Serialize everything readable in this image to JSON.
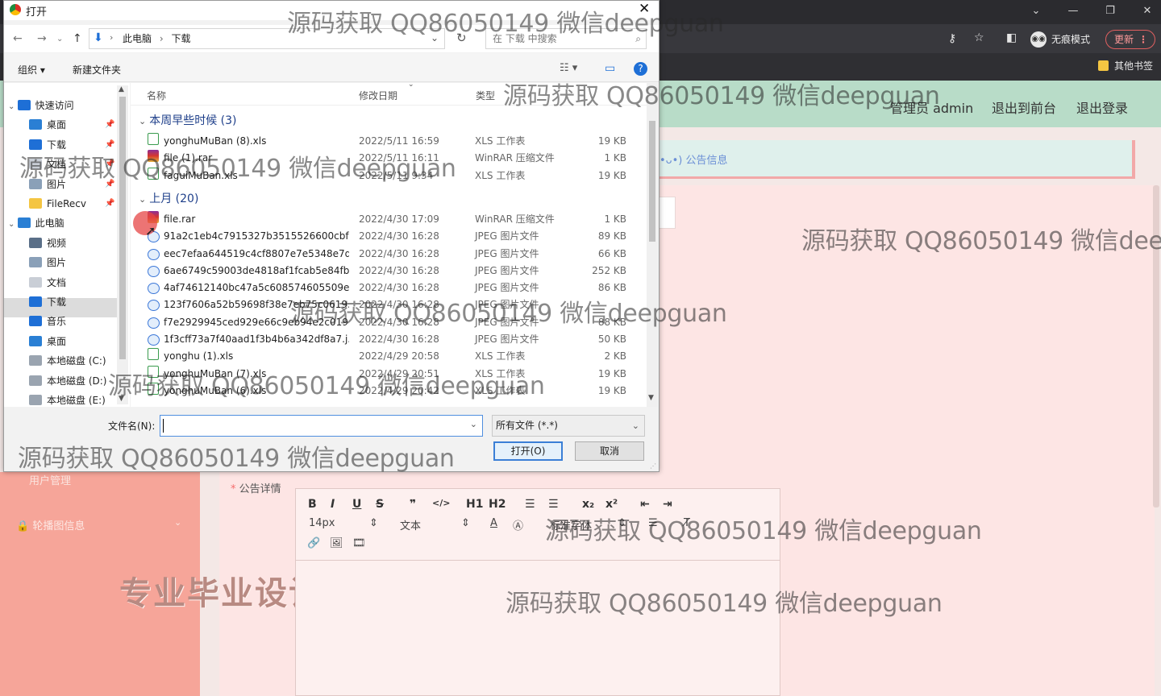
{
  "browser": {
    "window_controls": [
      "⌄",
      "—",
      "❐",
      "✕"
    ],
    "incognito_label": "无痕模式",
    "update_label": "更新",
    "bookmark_label": "其他书签"
  },
  "page": {
    "header_links": [
      "管理员 admin",
      "退出到前台",
      "退出登录"
    ],
    "notice_label": "•ᴗ•) 公告信息",
    "sidebar_items": [
      "用户管理",
      "轮播图信息"
    ],
    "stamp_text": "专业毕业设计代做",
    "field_label": "公告详情",
    "editor": {
      "toolbar_row1": [
        "B",
        "I",
        "U",
        "S",
        "❞",
        "</>",
        "H1",
        "H2",
        "☰",
        "☰",
        "x₂",
        "x²",
        "⇤",
        "⇥"
      ],
      "font_size": "14px",
      "text_style": "文本",
      "font_family": "标准字体",
      "toolbar_row3": [
        "🔗",
        "🖼",
        "🎞"
      ]
    }
  },
  "dialog": {
    "title": "打开",
    "close": "✕",
    "breadcrumb": [
      "此电脑",
      "下载"
    ],
    "search_placeholder": "在 下载 中搜索",
    "commands": [
      "组织 ▾",
      "新建文件夹"
    ],
    "nav_tree": [
      {
        "label": "快速访问",
        "level": 0
      },
      {
        "label": "桌面",
        "level": 1,
        "pinned": true
      },
      {
        "label": "下载",
        "level": 1,
        "pinned": true
      },
      {
        "label": "文档",
        "level": 1,
        "pinned": true
      },
      {
        "label": "图片",
        "level": 1,
        "pinned": true
      },
      {
        "label": "FileRecv",
        "level": 1,
        "pinned": true
      },
      {
        "label": "此电脑",
        "level": 0
      },
      {
        "label": "视频",
        "level": 1
      },
      {
        "label": "图片",
        "level": 1
      },
      {
        "label": "文档",
        "level": 1
      },
      {
        "label": "下载",
        "level": 1
      },
      {
        "label": "音乐",
        "level": 1
      },
      {
        "label": "桌面",
        "level": 1
      },
      {
        "label": "本地磁盘 (C:)",
        "level": 1
      },
      {
        "label": "本地磁盘 (D:)",
        "level": 1
      },
      {
        "label": "本地磁盘 (E:)",
        "level": 1
      }
    ],
    "columns": [
      "名称",
      "修改日期",
      "类型"
    ],
    "groups": [
      {
        "title": "本周早些时候 (3)",
        "files": [
          {
            "name": "yonghuMuBan (8).xls",
            "date": "2022/5/11 16:59",
            "type": "XLS 工作表",
            "size": "19 KB",
            "icon": "xls"
          },
          {
            "name": "file (1).rar",
            "date": "2022/5/11 16:11",
            "type": "WinRAR 压缩文件",
            "size": "1 KB",
            "icon": "rar"
          },
          {
            "name": "faguiMuBan.xls",
            "date": "2022/5/11 9:34",
            "type": "XLS 工作表",
            "size": "19 KB",
            "icon": "xls"
          }
        ]
      },
      {
        "title": "上月 (20)",
        "files": [
          {
            "name": "file.rar",
            "date": "2022/4/30 17:09",
            "type": "WinRAR 压缩文件",
            "size": "1 KB",
            "icon": "rar"
          },
          {
            "name": "91a2c1eb4c7915327b3515526600cbf...",
            "date": "2022/4/30 16:28",
            "type": "JPEG 图片文件",
            "size": "89 KB",
            "icon": "jpg"
          },
          {
            "name": "eec7efaa644519c4cf8807e7e5348e7d...",
            "date": "2022/4/30 16:28",
            "type": "JPEG 图片文件",
            "size": "66 KB",
            "icon": "jpg"
          },
          {
            "name": "6ae6749c59003de4818af1fcab5e84fb...",
            "date": "2022/4/30 16:28",
            "type": "JPEG 图片文件",
            "size": "252 KB",
            "icon": "jpg"
          },
          {
            "name": "4af74612140bc47a5c608574605509e...",
            "date": "2022/4/30 16:28",
            "type": "JPEG 图片文件",
            "size": "86 KB",
            "icon": "jpg"
          },
          {
            "name": "123f7606a52b59698f38e7eb75c0619...",
            "date": "2022/4/30 16:28",
            "type": "JPEG 图片文件",
            "size": "",
            "icon": "jpg"
          },
          {
            "name": "f7e2929945ced929e66c9eb94e2c019...",
            "date": "2022/4/30 16:28",
            "type": "JPEG 图片文件",
            "size": "88 KB",
            "icon": "jpg"
          },
          {
            "name": "1f3cff73a7f40aad1f3b4b6a342df8a7.j...",
            "date": "2022/4/30 16:28",
            "type": "JPEG 图片文件",
            "size": "50 KB",
            "icon": "jpg"
          },
          {
            "name": "yonghu (1).xls",
            "date": "2022/4/29 20:58",
            "type": "XLS 工作表",
            "size": "2 KB",
            "icon": "xls"
          },
          {
            "name": "yonghuMuBan (7).xls",
            "date": "2022/4/29 20:51",
            "type": "XLS 工作表",
            "size": "19 KB",
            "icon": "xls"
          },
          {
            "name": "yonghuMuBan (6).xls",
            "date": "2022/4/29 20:42",
            "type": "XLS 工作表",
            "size": "19 KB",
            "icon": "xls"
          }
        ]
      }
    ],
    "filename_label": "文件名(N):",
    "filename_value": "",
    "filetype": "所有文件 (*.*)",
    "open_button": "打开(O)",
    "cancel_button": "取消"
  },
  "watermarks": [
    "源码获取 QQ86050149 微信deepguan",
    "源码获取 QQ86050149 微信deepguan",
    "源码获取 QQ86050149 微信deepguan",
    "源码获取 QQ86050149 微信dee",
    "源码获取 QQ86050149 微信deepguan",
    "源码获取 QQ86050149 微信deepguan",
    "源码获取 QQ86050149 微信deepguan",
    "源码获取 QQ86050149 微信deepguan",
    "源码获取 QQ86050149 微信deepguan"
  ]
}
